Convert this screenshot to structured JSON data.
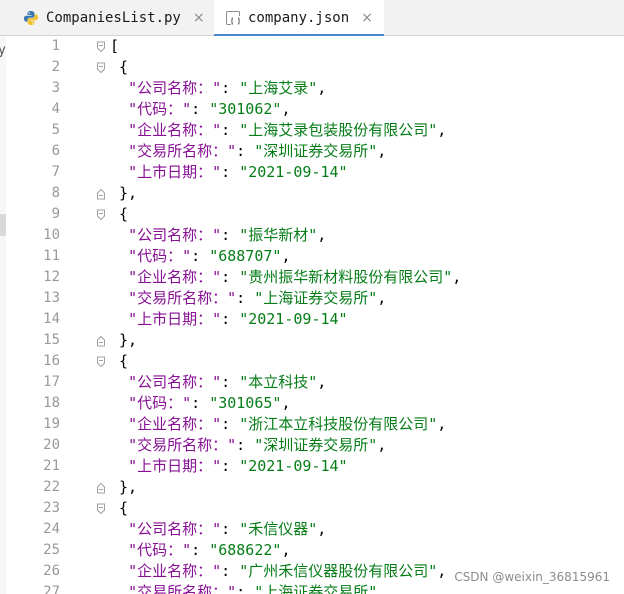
{
  "tabs": [
    {
      "label": "CompaniesList.py",
      "icon": "python-file-icon",
      "active": false
    },
    {
      "label": "company.json",
      "icon": "json-file-icon",
      "active": true
    }
  ],
  "tab_close_glyph": "×",
  "left_panel_fragment": "y",
  "colors": {
    "key": "#871094",
    "string": "#067d17",
    "active_tab_underline": "#4a88c7"
  },
  "editor": {
    "lines": [
      {
        "num": "1",
        "fold": "open",
        "tokens": [
          {
            "t": "punc",
            "v": "["
          }
        ]
      },
      {
        "num": "2",
        "fold": "open",
        "tokens": [
          {
            "t": "punc",
            "v": " {"
          }
        ]
      },
      {
        "num": "3",
        "tokens": [
          {
            "t": "punc",
            "v": "  "
          },
          {
            "t": "key",
            "v": "\"公司名称：\""
          },
          {
            "t": "punc",
            "v": ": "
          },
          {
            "t": "str",
            "v": "\"上海艾录\""
          },
          {
            "t": "punc",
            "v": ","
          }
        ]
      },
      {
        "num": "4",
        "tokens": [
          {
            "t": "punc",
            "v": "  "
          },
          {
            "t": "key",
            "v": "\"代码：\""
          },
          {
            "t": "punc",
            "v": ": "
          },
          {
            "t": "str",
            "v": "\"301062\""
          },
          {
            "t": "punc",
            "v": ","
          }
        ]
      },
      {
        "num": "5",
        "tokens": [
          {
            "t": "punc",
            "v": "  "
          },
          {
            "t": "key",
            "v": "\"企业名称：\""
          },
          {
            "t": "punc",
            "v": ": "
          },
          {
            "t": "str",
            "v": "\"上海艾录包装股份有限公司\""
          },
          {
            "t": "punc",
            "v": ","
          }
        ]
      },
      {
        "num": "6",
        "tokens": [
          {
            "t": "punc",
            "v": "  "
          },
          {
            "t": "key",
            "v": "\"交易所名称：\""
          },
          {
            "t": "punc",
            "v": ": "
          },
          {
            "t": "str",
            "v": "\"深圳证券交易所\""
          },
          {
            "t": "punc",
            "v": ","
          }
        ]
      },
      {
        "num": "7",
        "tokens": [
          {
            "t": "punc",
            "v": "  "
          },
          {
            "t": "key",
            "v": "\"上市日期：\""
          },
          {
            "t": "punc",
            "v": ": "
          },
          {
            "t": "str",
            "v": "\"2021-09-14\""
          }
        ]
      },
      {
        "num": "8",
        "fold": "close",
        "tokens": [
          {
            "t": "punc",
            "v": " },"
          }
        ]
      },
      {
        "num": "9",
        "fold": "open",
        "tokens": [
          {
            "t": "punc",
            "v": " {"
          }
        ]
      },
      {
        "num": "10",
        "tokens": [
          {
            "t": "punc",
            "v": "  "
          },
          {
            "t": "key",
            "v": "\"公司名称：\""
          },
          {
            "t": "punc",
            "v": ": "
          },
          {
            "t": "str",
            "v": "\"振华新材\""
          },
          {
            "t": "punc",
            "v": ","
          }
        ]
      },
      {
        "num": "11",
        "tokens": [
          {
            "t": "punc",
            "v": "  "
          },
          {
            "t": "key",
            "v": "\"代码：\""
          },
          {
            "t": "punc",
            "v": ": "
          },
          {
            "t": "str",
            "v": "\"688707\""
          },
          {
            "t": "punc",
            "v": ","
          }
        ]
      },
      {
        "num": "12",
        "tokens": [
          {
            "t": "punc",
            "v": "  "
          },
          {
            "t": "key",
            "v": "\"企业名称：\""
          },
          {
            "t": "punc",
            "v": ": "
          },
          {
            "t": "str",
            "v": "\"贵州振华新材料股份有限公司\""
          },
          {
            "t": "punc",
            "v": ","
          }
        ]
      },
      {
        "num": "13",
        "tokens": [
          {
            "t": "punc",
            "v": "  "
          },
          {
            "t": "key",
            "v": "\"交易所名称：\""
          },
          {
            "t": "punc",
            "v": ": "
          },
          {
            "t": "str",
            "v": "\"上海证券交易所\""
          },
          {
            "t": "punc",
            "v": ","
          }
        ]
      },
      {
        "num": "14",
        "tokens": [
          {
            "t": "punc",
            "v": "  "
          },
          {
            "t": "key",
            "v": "\"上市日期：\""
          },
          {
            "t": "punc",
            "v": ": "
          },
          {
            "t": "str",
            "v": "\"2021-09-14\""
          }
        ]
      },
      {
        "num": "15",
        "fold": "close",
        "tokens": [
          {
            "t": "punc",
            "v": " },"
          }
        ]
      },
      {
        "num": "16",
        "fold": "open",
        "tokens": [
          {
            "t": "punc",
            "v": " {"
          }
        ]
      },
      {
        "num": "17",
        "tokens": [
          {
            "t": "punc",
            "v": "  "
          },
          {
            "t": "key",
            "v": "\"公司名称：\""
          },
          {
            "t": "punc",
            "v": ": "
          },
          {
            "t": "str",
            "v": "\"本立科技\""
          },
          {
            "t": "punc",
            "v": ","
          }
        ]
      },
      {
        "num": "18",
        "tokens": [
          {
            "t": "punc",
            "v": "  "
          },
          {
            "t": "key",
            "v": "\"代码：\""
          },
          {
            "t": "punc",
            "v": ": "
          },
          {
            "t": "str",
            "v": "\"301065\""
          },
          {
            "t": "punc",
            "v": ","
          }
        ]
      },
      {
        "num": "19",
        "tokens": [
          {
            "t": "punc",
            "v": "  "
          },
          {
            "t": "key",
            "v": "\"企业名称：\""
          },
          {
            "t": "punc",
            "v": ": "
          },
          {
            "t": "str",
            "v": "\"浙江本立科技股份有限公司\""
          },
          {
            "t": "punc",
            "v": ","
          }
        ]
      },
      {
        "num": "20",
        "tokens": [
          {
            "t": "punc",
            "v": "  "
          },
          {
            "t": "key",
            "v": "\"交易所名称：\""
          },
          {
            "t": "punc",
            "v": ": "
          },
          {
            "t": "str",
            "v": "\"深圳证券交易所\""
          },
          {
            "t": "punc",
            "v": ","
          }
        ]
      },
      {
        "num": "21",
        "tokens": [
          {
            "t": "punc",
            "v": "  "
          },
          {
            "t": "key",
            "v": "\"上市日期：\""
          },
          {
            "t": "punc",
            "v": ": "
          },
          {
            "t": "str",
            "v": "\"2021-09-14\""
          }
        ]
      },
      {
        "num": "22",
        "fold": "close",
        "tokens": [
          {
            "t": "punc",
            "v": " },"
          }
        ]
      },
      {
        "num": "23",
        "fold": "open",
        "tokens": [
          {
            "t": "punc",
            "v": " {"
          }
        ]
      },
      {
        "num": "24",
        "tokens": [
          {
            "t": "punc",
            "v": "  "
          },
          {
            "t": "key",
            "v": "\"公司名称：\""
          },
          {
            "t": "punc",
            "v": ": "
          },
          {
            "t": "str",
            "v": "\"禾信仪器\""
          },
          {
            "t": "punc",
            "v": ","
          }
        ]
      },
      {
        "num": "25",
        "tokens": [
          {
            "t": "punc",
            "v": "  "
          },
          {
            "t": "key",
            "v": "\"代码：\""
          },
          {
            "t": "punc",
            "v": ": "
          },
          {
            "t": "str",
            "v": "\"688622\""
          },
          {
            "t": "punc",
            "v": ","
          }
        ]
      },
      {
        "num": "26",
        "tokens": [
          {
            "t": "punc",
            "v": "  "
          },
          {
            "t": "key",
            "v": "\"企业名称：\""
          },
          {
            "t": "punc",
            "v": ": "
          },
          {
            "t": "str",
            "v": "\"广州禾信仪器股份有限公司\""
          },
          {
            "t": "punc",
            "v": ","
          }
        ]
      },
      {
        "num": "27",
        "tokens": [
          {
            "t": "punc",
            "v": "  "
          },
          {
            "t": "key",
            "v": "\"交易所名称：\""
          },
          {
            "t": "punc",
            "v": ": "
          },
          {
            "t": "str",
            "v": "\"上海证券交易所\""
          },
          {
            "t": "punc",
            "v": ","
          }
        ]
      }
    ]
  },
  "watermark": "CSDN @weixin_36815961"
}
